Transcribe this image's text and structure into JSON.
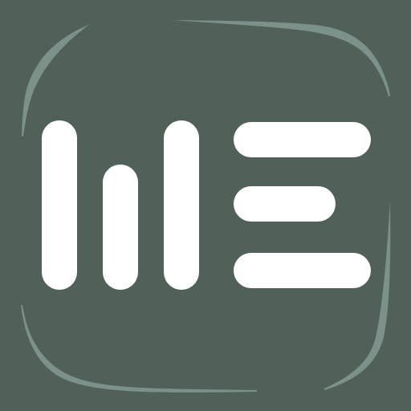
{
  "app_icon": {
    "name": "app-logo",
    "description_icon": "bars-and-lines-logo-icon",
    "colors": {
      "background": "#51615a",
      "border_accent": "#7b9189",
      "glyph": "#ffffff"
    }
  }
}
